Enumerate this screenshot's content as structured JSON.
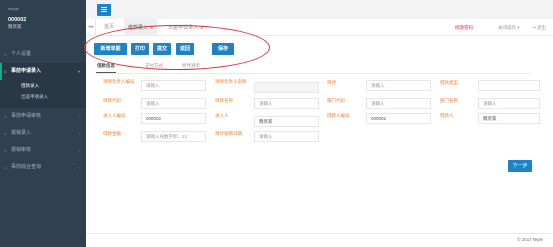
{
  "user": {
    "role": "image",
    "id": "000002",
    "name": "魏贤家"
  },
  "sidebar": {
    "items": [
      {
        "label": "个人设置",
        "icon": "home-icon"
      },
      {
        "label": "事前申请录入",
        "icon": "home-icon",
        "active": true
      },
      {
        "label": "事前申请审核",
        "icon": "home-icon"
      },
      {
        "label": "报销录入",
        "icon": "home-icon"
      },
      {
        "label": "报销审核",
        "icon": "home-icon"
      },
      {
        "label": "事前综合查询",
        "icon": "home-icon"
      }
    ],
    "subitems": [
      {
        "label": "借款录入"
      },
      {
        "label": "出差申请录入"
      }
    ]
  },
  "tabs": {
    "left_nav": "◂◂",
    "items": [
      {
        "label": "首页"
      },
      {
        "label": "借款录入",
        "close": "⊗",
        "active": true
      },
      {
        "label": "出差申请录入",
        "close": "⊗"
      }
    ],
    "change_password": "修改密码",
    "close_ops": "关闭操作 ▾",
    "exit": "⇥ 退出"
  },
  "actions": {
    "new_label": "新增单据",
    "print_label": "打印",
    "submit_label": "提交",
    "back_label": "返回",
    "save_label": "保存"
  },
  "form_tabs": [
    "借款信息",
    "支付方式",
    "附件清单"
  ],
  "form": {
    "rows": [
      [
        {
          "label": "项目负责人编号",
          "value": "请输入"
        },
        {
          "label": "项目负责人名称",
          "value": ""
        },
        {
          "label": "简述",
          "value": "请输入"
        },
        {
          "label": "借款类型",
          "value": ""
        }
      ],
      [
        {
          "label": "项目代码",
          "value": "请输入"
        },
        {
          "label": "项目名称",
          "value": "请输入"
        },
        {
          "label": "部门代码",
          "value": "请输入"
        },
        {
          "label": "部门名称",
          "value": "请输入"
        }
      ],
      [
        {
          "label": "录入人编号",
          "value": "000002",
          "filled": true
        },
        {
          "label": "录入人",
          "value": "魏贤家",
          "filled": true
        },
        {
          "label": "借款人编号",
          "value": "000002",
          "filled": true
        },
        {
          "label": "借款人",
          "value": "魏贤家",
          "filled": true
        }
      ],
      [
        {
          "label": "借款金额",
          "value": "请输入纯数字如：12"
        },
        {
          "label": "预计核销日期",
          "value": "请输入"
        }
      ]
    ]
  },
  "next_label": "下一步",
  "footer": {
    "text": "© 2017 Wyle"
  },
  "colors": {
    "sidebar": "#2f4050",
    "primary": "#1c84c6",
    "label": "#f0812d",
    "highlight": "#e02d3a"
  }
}
